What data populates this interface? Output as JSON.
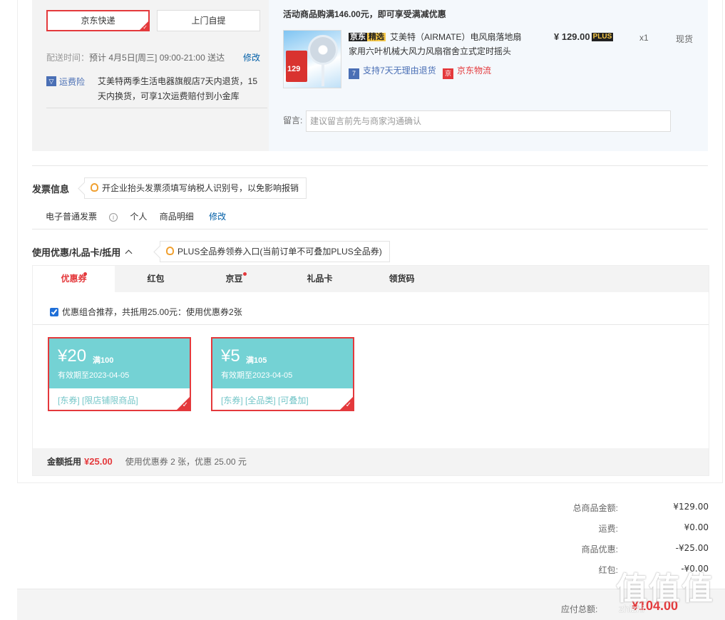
{
  "shipping": {
    "method_selected": "京东快递",
    "method_pickup": "上门自提",
    "delivery_label": "配送时间：",
    "delivery_time": "预计 4月5日[周三] 09:00-21:00 送达",
    "modify": "修改",
    "insurance_label": "运费险",
    "insurance_text": "艾美特两季生活电器旗舰店7天内退货，15天内换货，可享1次运费赔付到小金库"
  },
  "product": {
    "promo_title": "活动商品购满146.00元，即可享受满减优惠",
    "badge_a": "京东",
    "badge_b": "精选",
    "name": "艾美特（AIRMATE）电风扇落地扇家用六叶机械大风力风扇宿舍立式定时摇头",
    "price": "¥ 129.00",
    "plus": "PLUS",
    "qty": "x1",
    "stock": "现货",
    "img_price": "129",
    "service_return": "支持7天无理由退货",
    "service_logistics": "京东物流",
    "memo_label": "留言:",
    "memo_placeholder": "建议留言前先与商家沟通确认"
  },
  "invoice": {
    "title": "发票信息",
    "tip": "开企业抬头发票须填写纳税人识别号，以免影响报销",
    "type": "电子普通发票",
    "holder": "个人",
    "content": "商品明细",
    "modify": "修改"
  },
  "coupons": {
    "title": "使用优惠/礼品卡/抵用",
    "tip": "PLUS全品券领券入口(当前订单不可叠加PLUS全品券)",
    "tabs": [
      {
        "label": "优惠券",
        "dot": true
      },
      {
        "label": "红包",
        "dot": false
      },
      {
        "label": "京豆",
        "dot": true
      },
      {
        "label": "礼品卡",
        "dot": false
      },
      {
        "label": "领货码",
        "dot": false
      }
    ],
    "combo_text": "优惠组合推荐，共抵用25.00元：使用优惠券2张",
    "items": [
      {
        "amount": "¥20",
        "condition": "满100",
        "expiry": "有效期至2023-04-05",
        "tags": "[东券] [限店铺限商品]"
      },
      {
        "amount": "¥5",
        "condition": "满105",
        "expiry": "有效期至2023-04-05",
        "tags": "[东券] [全品类] [可叠加]"
      }
    ],
    "footer_label": "金额抵用",
    "footer_amount": "¥25.00",
    "footer_desc": "使用优惠券 2 张，优惠 25.00 元"
  },
  "totals": {
    "rows": [
      {
        "label": "总商品金额:",
        "value": "¥129.00"
      },
      {
        "label": "运费:",
        "value": "¥0.00"
      },
      {
        "label": "商品优惠:",
        "value": "-¥25.00"
      },
      {
        "label": "红包:",
        "value": "-¥0.00"
      }
    ],
    "pay_label": "应付总额:",
    "pay_value": "¥104.00"
  },
  "watermark": {
    "text": "值值值",
    "site": "zhizhi"
  },
  "colors": {
    "accent": "#e4393c",
    "link": "#005ea7",
    "coupon": "#74d2d4"
  }
}
